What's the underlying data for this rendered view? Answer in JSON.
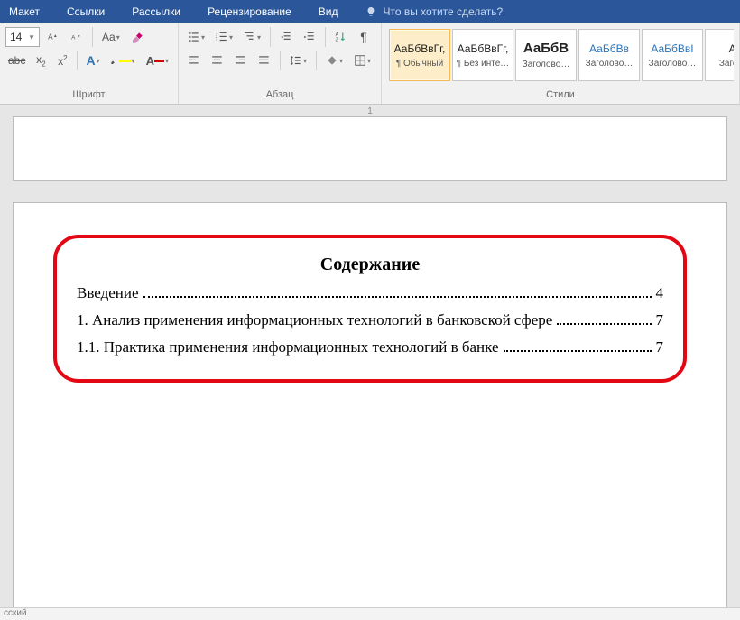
{
  "menubar": {
    "items": [
      "Макет",
      "Ссылки",
      "Рассылки",
      "Рецензирование",
      "Вид"
    ],
    "tell_me": "Что вы хотите сделать?"
  },
  "ribbon": {
    "font": {
      "size": "14",
      "group_label": "Шрифт"
    },
    "paragraph": {
      "group_label": "Абзац"
    },
    "styles": {
      "group_label": "Стили",
      "tiles": [
        {
          "sample": "АаБбВвГг,",
          "label": "¶ Обычный",
          "selected": true,
          "sample_class": ""
        },
        {
          "sample": "АаБбВвГг,",
          "label": "¶ Без инте…",
          "selected": false,
          "sample_class": ""
        },
        {
          "sample": "АаБбВ",
          "label": "Заголово…",
          "selected": false,
          "sample_class": "bold"
        },
        {
          "sample": "АаБбВв",
          "label": "Заголово…",
          "selected": false,
          "sample_class": "blue"
        },
        {
          "sample": "АаБбВвI",
          "label": "Заголово…",
          "selected": false,
          "sample_class": "blue"
        },
        {
          "sample": "Аа",
          "label": "Загол…",
          "selected": false,
          "sample_class": ""
        }
      ]
    }
  },
  "ruler": {
    "page_number": "1"
  },
  "document": {
    "toc": {
      "title": "Содержание",
      "entries": [
        {
          "text": "Введение",
          "page": "4"
        },
        {
          "text": "1.  Анализ применения информационных технологий в банковской сфере",
          "page": "7"
        },
        {
          "text": "1.1.   Практика применения информационных технологий в банке",
          "page": "7"
        }
      ]
    }
  },
  "statusbar": {
    "lang": "сский"
  }
}
